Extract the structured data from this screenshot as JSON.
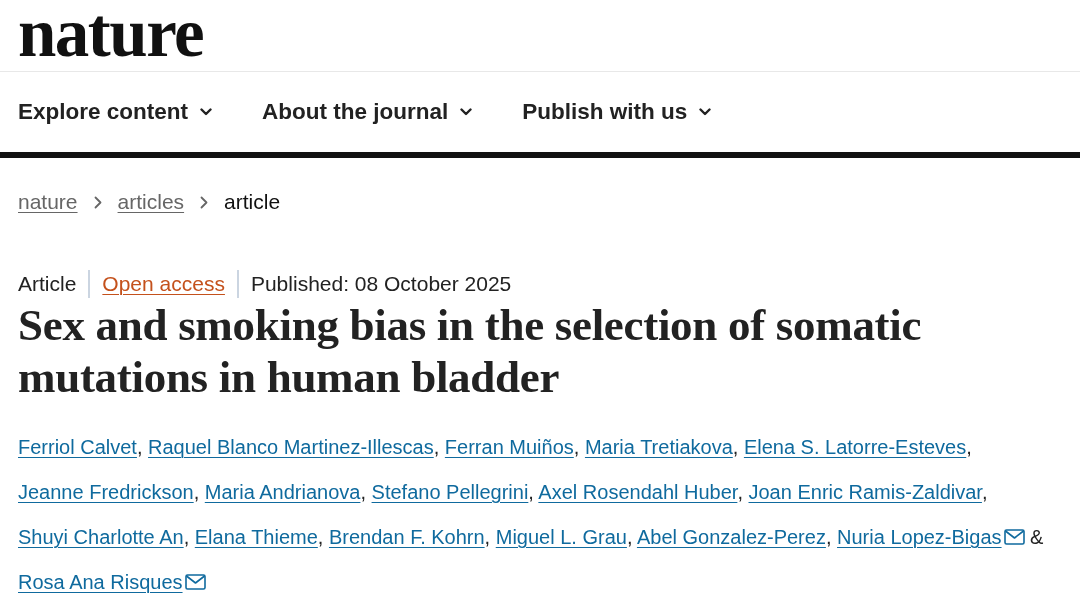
{
  "header": {
    "logo": "nature"
  },
  "nav": [
    {
      "label": "Explore content"
    },
    {
      "label": "About the journal"
    },
    {
      "label": "Publish with us"
    }
  ],
  "breadcrumb": [
    {
      "label": "nature",
      "kind": "link"
    },
    {
      "label": "articles",
      "kind": "link"
    },
    {
      "label": "article",
      "kind": "current"
    }
  ],
  "meta": [
    {
      "label": "Article",
      "kind": "type"
    },
    {
      "label": "Open access",
      "kind": "access"
    },
    {
      "label": "Published: 08 October 2025",
      "kind": "date"
    }
  ],
  "title": "Sex and smoking bias in the selection of somatic mutations in human bladder",
  "authors": [
    {
      "name": "Ferriol Calvet",
      "separator": ",",
      "corresponding": false
    },
    {
      "name": "Raquel Blanco Martinez-Illescas",
      "separator": ",",
      "corresponding": false
    },
    {
      "name": "Ferran Muiños",
      "separator": ",",
      "corresponding": false
    },
    {
      "name": "Maria Tretiakova",
      "separator": ",",
      "corresponding": false
    },
    {
      "name": "Elena S. Latorre-Esteves",
      "separator": ",",
      "corresponding": false
    },
    {
      "name": "Jeanne Fredrickson",
      "separator": ",",
      "corresponding": false
    },
    {
      "name": "Maria Andrianova",
      "separator": ",",
      "corresponding": false
    },
    {
      "name": "Stefano Pellegrini",
      "separator": ",",
      "corresponding": false
    },
    {
      "name": "Axel Rosendahl Huber",
      "separator": ",",
      "corresponding": false
    },
    {
      "name": "Joan Enric Ramis-Zaldivar",
      "separator": ",",
      "corresponding": false
    },
    {
      "name": "Shuyi Charlotte An",
      "separator": ",",
      "corresponding": false
    },
    {
      "name": "Elana Thieme",
      "separator": ",",
      "corresponding": false
    },
    {
      "name": "Brendan F. Kohrn",
      "separator": ",",
      "corresponding": false
    },
    {
      "name": "Miguel L. Grau",
      "separator": ",",
      "corresponding": false
    },
    {
      "name": "Abel Gonzalez-Perez",
      "separator": ",",
      "corresponding": false
    },
    {
      "name": "Nuria Lopez-Bigas",
      "separator": "&",
      "corresponding": true
    },
    {
      "name": "Rosa Ana Risques",
      "corresponding": true
    }
  ]
}
